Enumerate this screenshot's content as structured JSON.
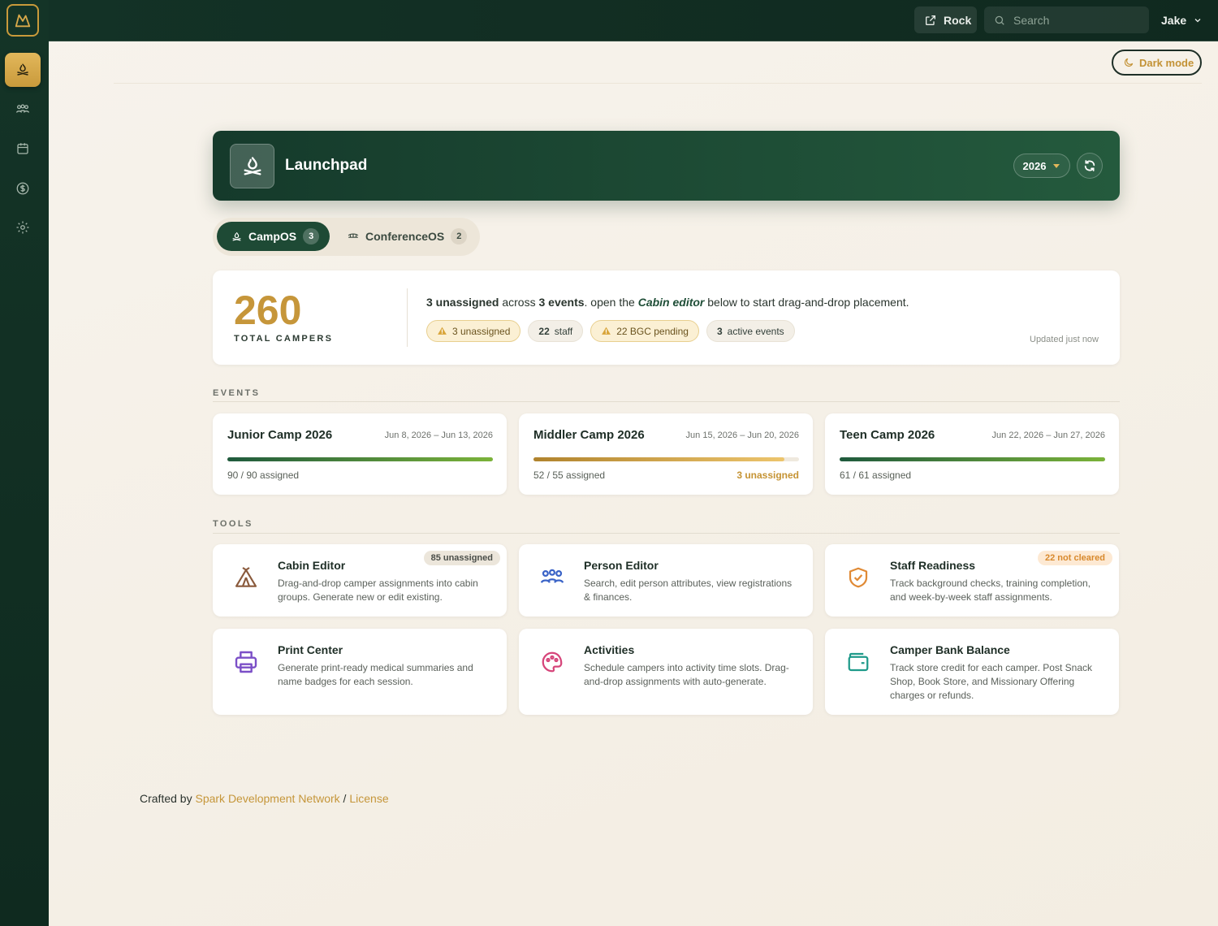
{
  "topbar": {
    "rock_label": "Rock",
    "search_placeholder": "Search",
    "user_name": "Jake",
    "dark_mode_label": "Dark mode"
  },
  "sidebar": {
    "items": [
      {
        "name": "campfire",
        "active": true
      },
      {
        "name": "people",
        "active": false
      },
      {
        "name": "calendar",
        "active": false
      },
      {
        "name": "dollar",
        "active": false
      },
      {
        "name": "settings",
        "active": false
      }
    ]
  },
  "hero": {
    "title": "Launchpad",
    "year": "2026"
  },
  "tabs": [
    {
      "label": "CampOS",
      "count": "3",
      "active": true
    },
    {
      "label": "ConferenceOS",
      "count": "2",
      "active": false
    }
  ],
  "summary": {
    "total": "260",
    "total_label": "TOTAL CAMPERS",
    "msg_count": "3 unassigned",
    "msg_across": " across ",
    "msg_events": "3 events",
    "msg_open": ". open the ",
    "msg_link": "Cabin editor",
    "msg_rest": " below to start drag-and-drop placement.",
    "chips": {
      "unassigned": "3 unassigned",
      "staff_num": "22",
      "staff_label": "staff",
      "bgc": "22 BGC pending",
      "events_num": "3",
      "events_label": "active events"
    },
    "updated": "Updated just now"
  },
  "sections": {
    "events": "EVENTS",
    "tools": "TOOLS"
  },
  "events": [
    {
      "title": "Junior Camp 2026",
      "dates": "Jun 8, 2026 – Jun 13, 2026",
      "assigned": "90 / 90 assigned",
      "progress": 1.0,
      "unassigned": ""
    },
    {
      "title": "Middler Camp 2026",
      "dates": "Jun 15, 2026 – Jun 20, 2026",
      "assigned": "52 / 55 assigned",
      "progress": 0.945,
      "unassigned": "3 unassigned"
    },
    {
      "title": "Teen Camp 2026",
      "dates": "Jun 22, 2026 – Jun 27, 2026",
      "assigned": "61 / 61 assigned",
      "progress": 1.0,
      "unassigned": ""
    }
  ],
  "tools": [
    {
      "title": "Cabin Editor",
      "desc": "Drag-and-drop camper assignments into cabin groups. Generate new or edit existing.",
      "badge": "85 unassigned",
      "icon": "tent-icon",
      "color": "#8a5a3c"
    },
    {
      "title": "Person Editor",
      "desc": "Search, edit person attributes, view registrations & finances.",
      "badge": "",
      "icon": "people-icon",
      "color": "#3a63c7"
    },
    {
      "title": "Staff Readiness",
      "desc": "Track background checks, training completion, and week-by-week staff assignments.",
      "badge": "22 not cleared",
      "icon": "shield-check-icon",
      "color": "#e08a35"
    },
    {
      "title": "Print Center",
      "desc": "Generate print-ready medical summaries and name badges for each session.",
      "badge": "",
      "icon": "printer-icon",
      "color": "#7b4fc7"
    },
    {
      "title": "Activities",
      "desc": "Schedule campers into activity time slots. Drag-and-drop assignments with auto-generate.",
      "badge": "",
      "icon": "palette-icon",
      "color": "#d6457a"
    },
    {
      "title": "Camper Bank Balance",
      "desc": "Track store credit for each camper. Post Snack Shop, Book Store, and Missionary Offering charges or refunds.",
      "badge": "",
      "icon": "wallet-icon",
      "color": "#1f9a8a"
    }
  ],
  "footer": {
    "prefix": "Crafted by ",
    "link": "Spark Development Network",
    "sep": " / ",
    "license": "License"
  }
}
